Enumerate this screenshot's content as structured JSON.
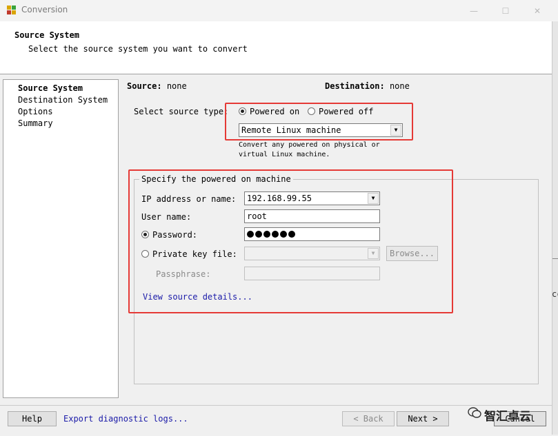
{
  "window": {
    "title": "Conversion",
    "controls": {
      "minimize": "—",
      "maximize": "☐",
      "close": "✕"
    }
  },
  "header": {
    "title": "Source System",
    "subtitle": "Select the source system you want to convert"
  },
  "nav": {
    "items": [
      "Source System",
      "Destination System",
      "Options",
      "Summary"
    ]
  },
  "summary": {
    "source_label": "Source:",
    "source_value": "none",
    "dest_label": "Destination:",
    "dest_value": "none"
  },
  "source_type": {
    "label": "Select source type:",
    "powered_on": "Powered on",
    "powered_off": "Powered off",
    "selected": "powered_on",
    "machine_type": "Remote Linux machine",
    "description": "Convert any powered on physical or virtual Linux machine."
  },
  "machine": {
    "group_title": "Specify the powered on machine",
    "ip_label": "IP address or name:",
    "ip_value": "192.168.99.55",
    "user_label": "User name:",
    "user_value": "root",
    "password_label": "Password:",
    "password_dots": 6,
    "key_label": "Private key file:",
    "browse_label": "Browse...",
    "passphrase_label": "Passphrase:",
    "details_link": "View source details..."
  },
  "footer": {
    "help": "Help",
    "export_logs": "Export diagnostic logs...",
    "back": "< Back",
    "next": "Next >",
    "cancel": "Cancel"
  },
  "edge_text": "cc",
  "watermark": "智汇卓云",
  "colors": {
    "annotation_red": "#e53935",
    "link": "#1a1aa8"
  }
}
